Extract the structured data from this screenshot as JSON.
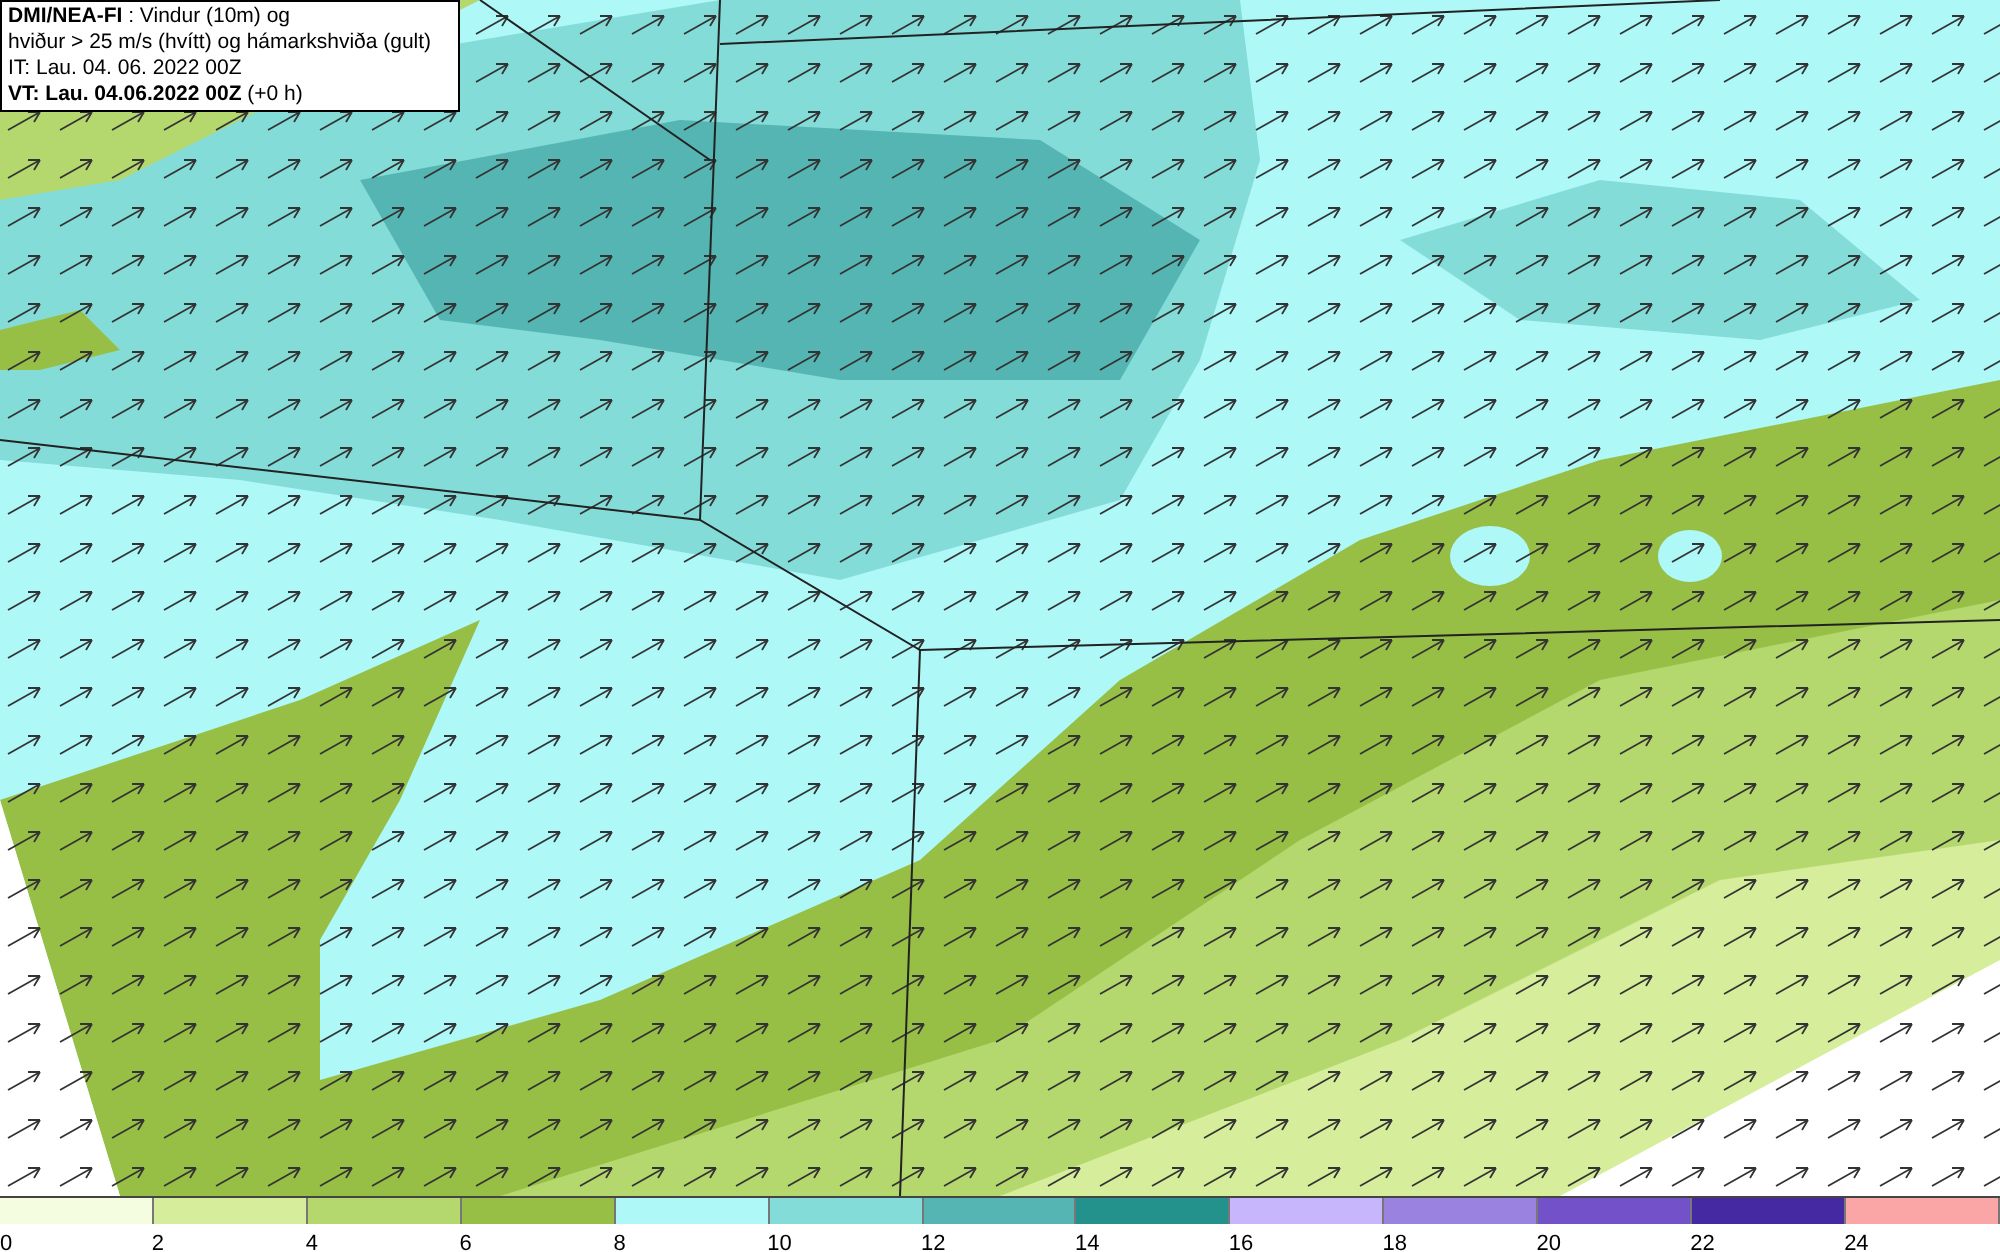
{
  "legend": {
    "lines": [
      "**DMI/NEA-FI** : Vindur (10m) og",
      "hviður > 25 m/s (hvítt) og hámarkshviða (gult)",
      "IT: Lau. 04. 06. 2022 00Z",
      "**VT: Lau. 04.06.2022 00Z** (+0 h)"
    ]
  },
  "color_scale": {
    "bins": [
      {
        "color": "#f4fde0"
      },
      {
        "color": "#d6ee9c"
      },
      {
        "color": "#b5d86e"
      },
      {
        "color": "#97bf46"
      },
      {
        "color": "#aef8f8"
      },
      {
        "color": "#84dcd9"
      },
      {
        "color": "#54b5b2"
      },
      {
        "color": "#23928d"
      },
      {
        "color": "#c7b6fc"
      },
      {
        "color": "#9a82e0"
      },
      {
        "color": "#7351c8"
      },
      {
        "color": "#4529a3"
      },
      {
        "color": "#fba6a6"
      }
    ],
    "labels": [
      "0",
      "2",
      "4",
      "6",
      "8",
      "10",
      "12",
      "14",
      "16",
      "18",
      "20",
      "22",
      "24"
    ]
  }
}
